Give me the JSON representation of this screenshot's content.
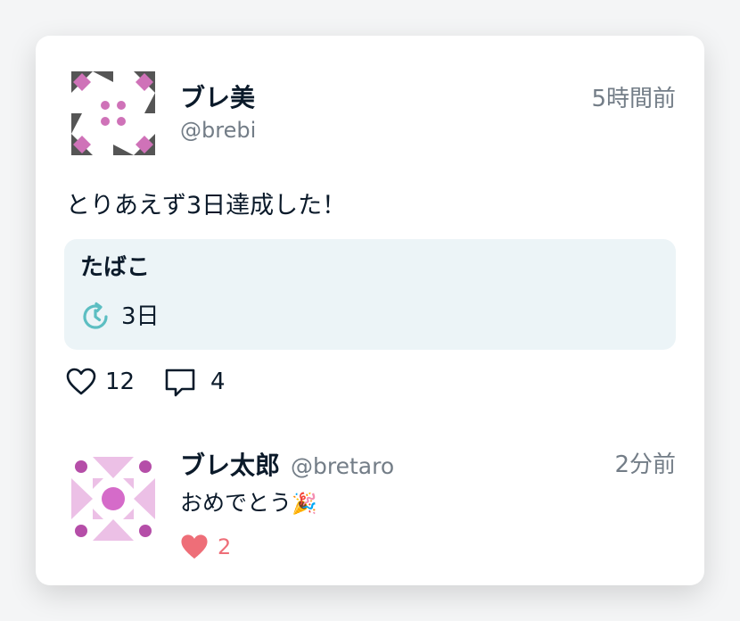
{
  "post": {
    "author_name": "ブレ美",
    "author_handle": "@brebi",
    "timestamp": "5時間前",
    "body": "とりあえず3日達成した！",
    "habit": {
      "name": "たばこ",
      "streak": "3日",
      "icon": "clock-restart-icon"
    },
    "likes": "12",
    "comments": "4",
    "like_icon": "heart-outline-icon",
    "comment_icon": "speech-bubble-icon"
  },
  "reply": {
    "author_name": "ブレ太郎",
    "author_handle": "@bretaro",
    "timestamp": "2分前",
    "body": "おめでとう",
    "emoji": "🎉",
    "likes": "2",
    "like_icon": "heart-filled-icon"
  },
  "colors": {
    "text": "#0b1a2a",
    "muted": "#737d87",
    "habit_bg": "#ecf4f7",
    "teal": "#5cbec2",
    "like_red": "#ee6e78",
    "brebi_pink": "#cf72b8",
    "brebi_gray": "#555555",
    "bretaro_pink": "#d56bc9",
    "bretaro_light": "#ecc0e6",
    "bretaro_purple": "#b54ea8"
  }
}
